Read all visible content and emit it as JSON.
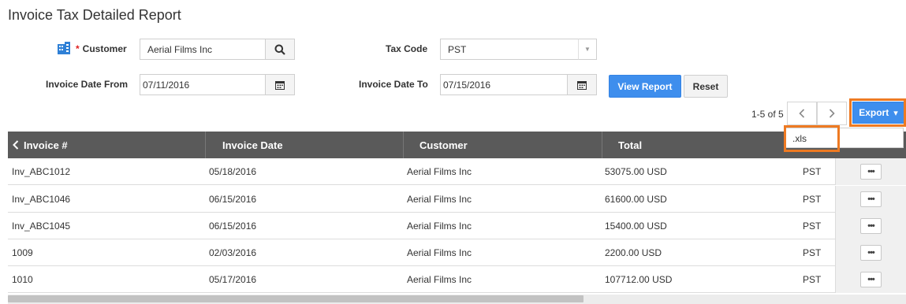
{
  "page": {
    "title": "Invoice Tax Detailed Report"
  },
  "filters": {
    "customer": {
      "label": "Customer",
      "required_mark": "*",
      "value": "Aerial Films Inc",
      "icon": "building-icon",
      "search_icon": "search-icon"
    },
    "tax_code": {
      "label": "Tax Code",
      "value": "PST",
      "icon": "chevron-down-icon"
    },
    "date_from": {
      "label": "Invoice Date From",
      "value": "07/11/2016",
      "icon": "calendar-icon"
    },
    "date_to": {
      "label": "Invoice Date To",
      "value": "07/15/2016",
      "icon": "calendar-icon"
    },
    "view_report_label": "View Report",
    "reset_label": "Reset"
  },
  "pager": {
    "text": "1-5 of 5",
    "prev_icon": "chevron-left-icon",
    "next_icon": "chevron-right-icon"
  },
  "export": {
    "label": "Export",
    "caret": "▾",
    "options": [
      ".xls"
    ]
  },
  "table": {
    "columns": [
      "Invoice #",
      "Invoice Date",
      "Customer",
      "Total"
    ],
    "sort_icon": "chevron-left-icon",
    "rows": [
      {
        "invoice": "Inv_ABC1012",
        "date": "05/18/2016",
        "customer": "Aerial Films Inc",
        "total": "53075.00",
        "currency": "USD",
        "tax": "PST",
        "more": "•••"
      },
      {
        "invoice": "Inv_ABC1046",
        "date": "06/15/2016",
        "customer": "Aerial Films Inc",
        "total": "61600.00",
        "currency": "USD",
        "tax": "PST",
        "more": "•••"
      },
      {
        "invoice": "Inv_ABC1045",
        "date": "06/15/2016",
        "customer": "Aerial Films Inc",
        "total": "15400.00",
        "currency": "USD",
        "tax": "PST",
        "more": "•••"
      },
      {
        "invoice": "1009",
        "date": "02/03/2016",
        "customer": "Aerial Films Inc",
        "total": "2200.00",
        "currency": "USD",
        "tax": "PST",
        "more": "•••"
      },
      {
        "invoice": "1010",
        "date": "05/17/2016",
        "customer": "Aerial Films Inc",
        "total": "107712.00",
        "currency": "USD",
        "tax": "PST",
        "more": "•••"
      }
    ]
  },
  "colors": {
    "primary": "#3e8eed",
    "highlight": "#ee7a22",
    "header_bg": "#5a5a5a",
    "icon_blue": "#2f80d6",
    "required": "#e02020"
  }
}
